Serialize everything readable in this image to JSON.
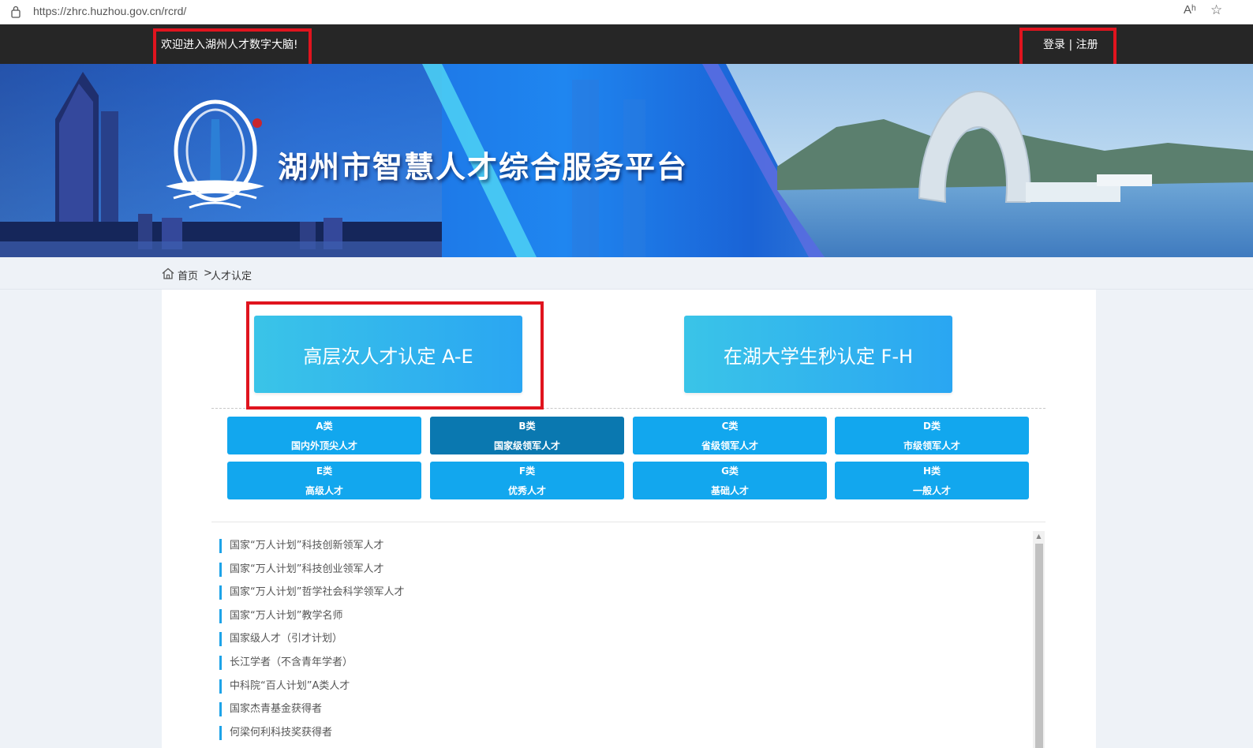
{
  "browser": {
    "url": "https://zhrc.huzhou.gov.cn/rcrd/",
    "read_aloud_icon": "Aʰ",
    "favorite_icon": "☆"
  },
  "topbar": {
    "welcome": "欢迎进入湖州人才数字大脑!",
    "login": "登录",
    "divider": " | ",
    "register": "注册"
  },
  "banner": {
    "title": "湖州市智慧人才综合服务平台"
  },
  "breadcrumb": {
    "home": "首页",
    "separator": ">",
    "current": "人才认定"
  },
  "main": {
    "big_buttons": [
      {
        "label": "高层次人才认定 A-E"
      },
      {
        "label": "在湖大学生秒认定 F-H"
      }
    ],
    "categories": [
      {
        "code": "A类",
        "name": "国内外顶尖人才"
      },
      {
        "code": "B类",
        "name": "国家级领军人才"
      },
      {
        "code": "C类",
        "name": "省级领军人才"
      },
      {
        "code": "D类",
        "name": "市级领军人才"
      },
      {
        "code": "E类",
        "name": "高级人才"
      },
      {
        "code": "F类",
        "name": "优秀人才"
      },
      {
        "code": "G类",
        "name": "基础人才"
      },
      {
        "code": "H类",
        "name": "一般人才"
      }
    ],
    "active_category": "B类",
    "list": [
      "国家“万人计划”科技创新领军人才",
      "国家“万人计划”科技创业领军人才",
      "国家“万人计划”哲学社会科学领军人才",
      "国家“万人计划”教学名师",
      "国家级人才（引才计划）",
      "长江学者（不含青年学者）",
      "中科院“百人计划”A类人才",
      "国家杰青基金获得者",
      "何梁何利科技奖获得者"
    ]
  },
  "colors": {
    "topbar_bg": "#262626",
    "highlight_red": "#e0141e",
    "category_blue": "#12a7ee",
    "category_active": "#0a78b0",
    "list_marker": "#1da3e8"
  }
}
